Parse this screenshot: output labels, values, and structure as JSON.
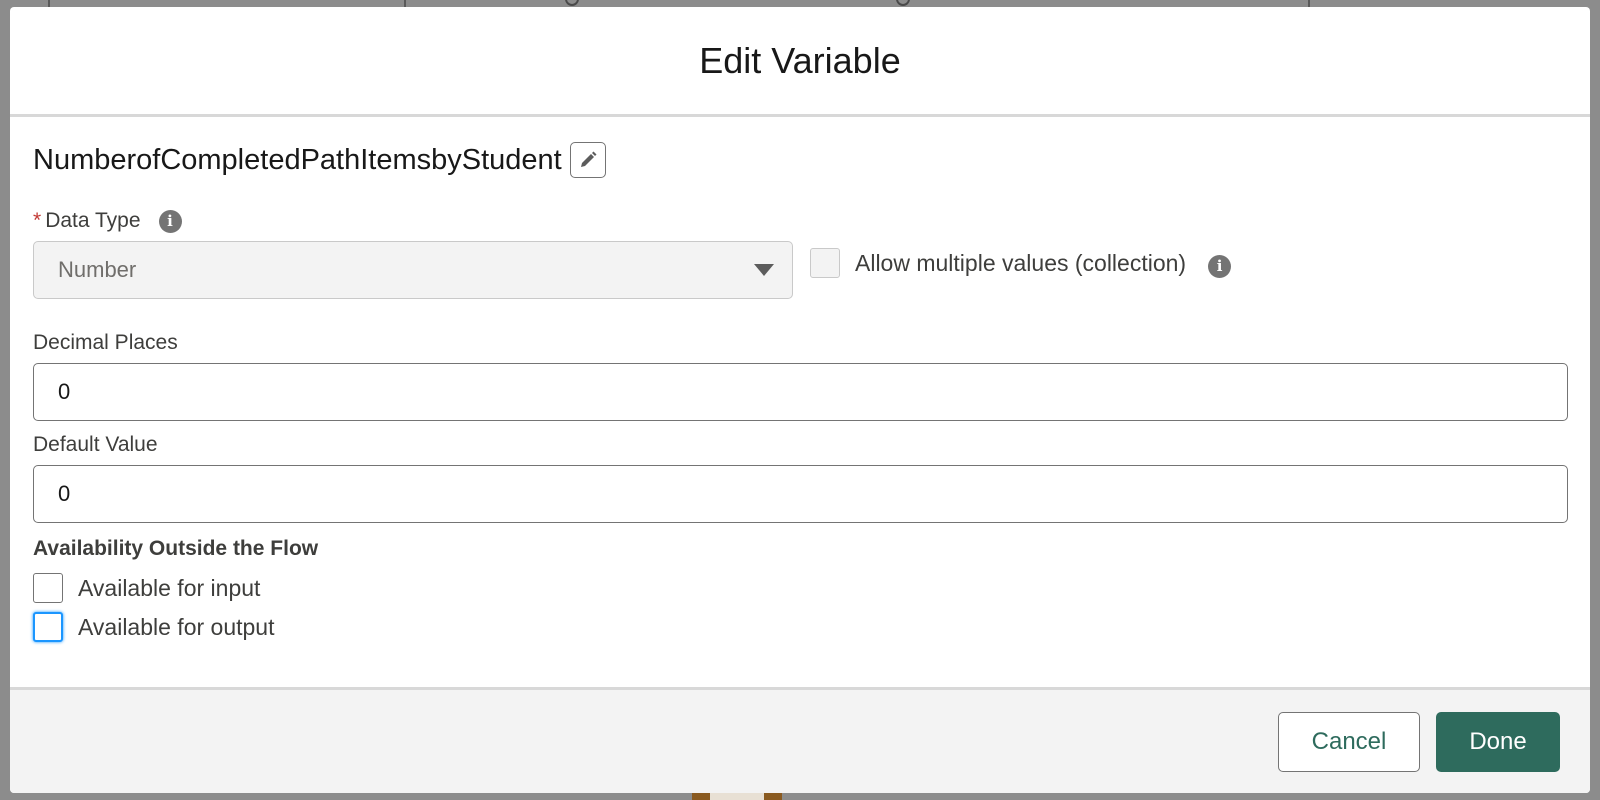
{
  "modal": {
    "title": "Edit Variable"
  },
  "variable": {
    "api_name": "NumberofCompletedPathItemsbyStudent"
  },
  "data_type": {
    "required_marker": "*",
    "label": "Data Type",
    "value": "Number",
    "disabled": true
  },
  "collection": {
    "label": "Allow multiple values (collection)",
    "checked": false,
    "disabled": true
  },
  "decimal_places": {
    "label": "Decimal Places",
    "value": "0"
  },
  "default_value": {
    "label": "Default Value",
    "value": "0"
  },
  "availability": {
    "heading": "Availability Outside the Flow",
    "input_label": "Available for input",
    "input_checked": false,
    "output_label": "Available for output",
    "output_checked": false
  },
  "footer": {
    "cancel_label": "Cancel",
    "done_label": "Done"
  },
  "colors": {
    "brand": "#2e6b5d",
    "required": "#c23934",
    "focus": "#1b96ff"
  },
  "icons": {
    "info": "info-icon",
    "edit": "pencil-icon",
    "dropdown": "chevron-down-icon"
  }
}
